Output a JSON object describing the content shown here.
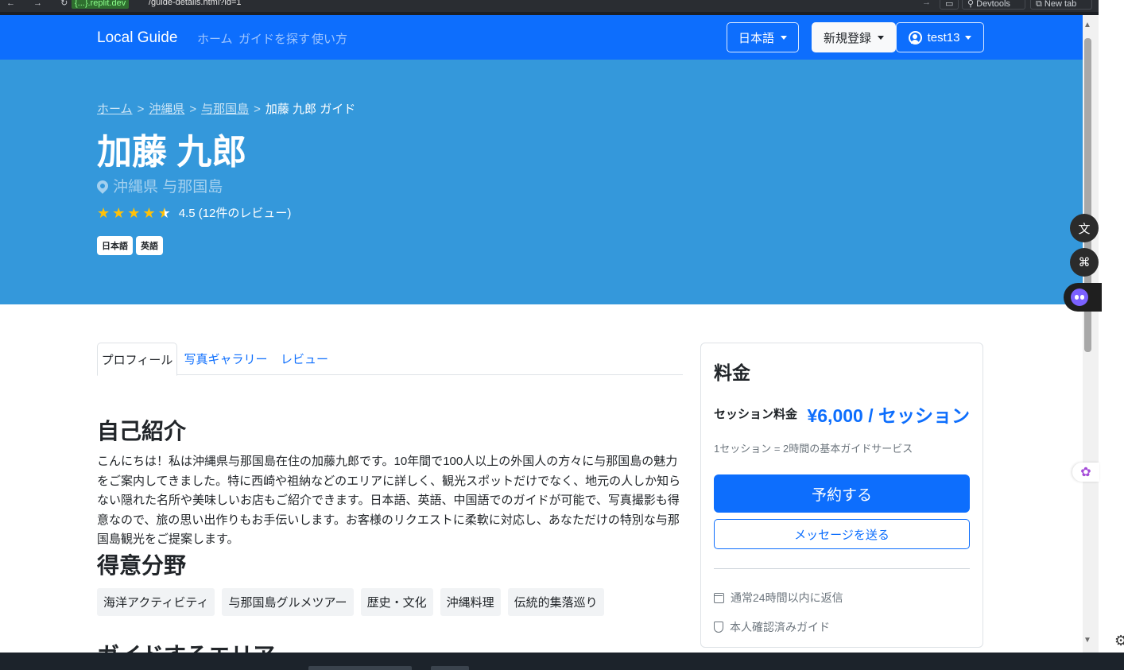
{
  "browser": {
    "nav_glyphs": "← → ↻",
    "url_host": "{...}.replit.dev",
    "url_path": "/guide-details.html?id=1",
    "devtools_label": "Devtools",
    "newtab_label": "New tab"
  },
  "navbar": {
    "brand": "Local Guide",
    "links": [
      "ホーム",
      "ガイドを探す",
      "使い方"
    ],
    "language_label": "日本語",
    "register_label": "新規登録",
    "user_label": "test13",
    "color": "#0d6efd"
  },
  "hero": {
    "breadcrumb": [
      "ホーム",
      "沖縄県",
      "与那国島"
    ],
    "breadcrumb_current": "加藤 九郎 ガイド",
    "name": "加藤 九郎",
    "location": "沖縄県 与那国島",
    "rating": 4.5,
    "rating_text": "4.5 (12件のレビュー)",
    "languages": [
      "日本語",
      "英語"
    ],
    "color": "#3498db"
  },
  "tabs": [
    "プロフィール",
    "写真ギャラリー",
    "レビュー"
  ],
  "profile": {
    "intro_heading": "自己紹介",
    "intro_text": "こんにちは！私は沖縄県与那国島在住の加藤九郎です。10年間で100人以上の外国人の方々に与那国島の魅力をご案内してきました。特に西崎や祖納などのエリアに詳しく、観光スポットだけでなく、地元の人しか知らない隠れた名所や美味しいお店もご紹介できます。日本語、英語、中国語でのガイドが可能で、写真撮影も得意なので、旅の思い出作りもお手伝いします。お客様のリクエストに柔軟に対応し、あなただけの特別な与那国島観光をご提案します。",
    "specialties_heading": "得意分野",
    "specialties": [
      "海洋アクティビティ",
      "与那国島グルメツアー",
      "歴史・文化",
      "沖縄料理",
      "伝統的集落巡り"
    ],
    "areas_heading": "ガイドするエリア"
  },
  "pricing": {
    "title": "料金",
    "session_label": "セッション料金",
    "price": "¥6,000 / セッション",
    "note": "1セッション = 2時間の基本ガイドサービス",
    "book_label": "予約する",
    "message_label": "メッセージを送る",
    "features": [
      "通常24時間以内に返信",
      "本人確認済みガイド"
    ]
  }
}
